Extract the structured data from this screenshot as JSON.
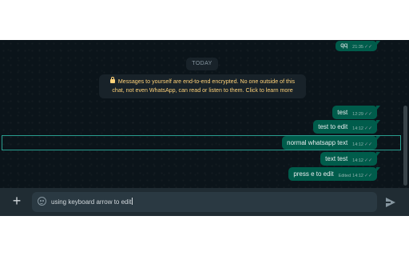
{
  "date_chip": "TODAY",
  "encryption_notice": "Messages to yourself are end-to-end encrypted. No one outside of this chat, not even WhatsApp, can read or listen to them. Click to learn more",
  "messages": [
    {
      "text": "qq",
      "time": "21:35",
      "edited": ""
    },
    {
      "text": "test",
      "time": "12:29",
      "edited": ""
    },
    {
      "text": "test to edit",
      "time": "14:12",
      "edited": ""
    },
    {
      "text": "normal whatsapp text",
      "time": "14:12",
      "edited": ""
    },
    {
      "text": "text test",
      "time": "14:12",
      "edited": ""
    },
    {
      "text": "press e to edit",
      "time": "14:12",
      "edited": "Edited"
    }
  ],
  "composer": {
    "text": "using keyboard arrow to edit",
    "plus_icon": "plus-icon",
    "emoji_icon": "emoji-icon",
    "send_icon": "send-icon"
  },
  "colors": {
    "chat_background": "#0b141a",
    "outgoing_bubble": "#005c4b",
    "highlight_border": "#2a9d8f",
    "input_bar": "#202c33"
  }
}
